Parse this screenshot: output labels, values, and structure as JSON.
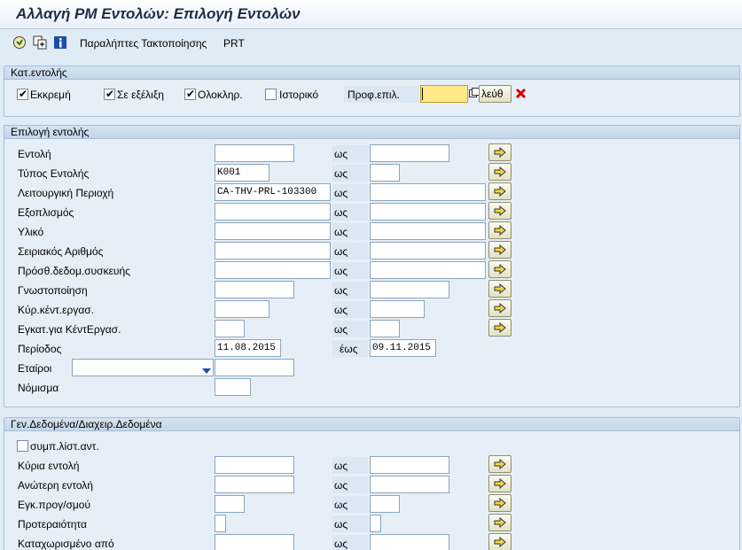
{
  "window": {
    "title": "Αλλαγή PM Εντολών: Επιλογή Εντολών"
  },
  "toolbar": {
    "execute_icon": "execute-icon",
    "copy_icon": "copy-icon",
    "info_icon": "info-icon",
    "items": [
      "Παραλήπτες Τακτοποίησης",
      "PRT"
    ]
  },
  "status_group": {
    "title": "Κατ.εντολής",
    "checkboxes": [
      {
        "label": "Εκκρεμή",
        "checked": true
      },
      {
        "label": "Σε εξέλιξη",
        "checked": true
      },
      {
        "label": "Ολοκληρ.",
        "checked": true
      },
      {
        "label": "Ιστορικό",
        "checked": false
      }
    ],
    "profile_label": "Προφ.επιλ.",
    "profile_value": "",
    "free_button": "λεύθ"
  },
  "selection_group": {
    "title": "Επιλογή εντολής",
    "to_label": "ως",
    "period_to_label": "έως",
    "rows": [
      {
        "label": "Εντολή",
        "from": "",
        "to": ""
      },
      {
        "label": "Τύπος Εντολής",
        "from": "K001",
        "to": ""
      },
      {
        "label": "Λειτουργική Περιοχή",
        "from": "CA-THV-PRL-103300",
        "to": ""
      },
      {
        "label": "Εξοπλισμός",
        "from": "",
        "to": ""
      },
      {
        "label": "Υλικό",
        "from": "",
        "to": ""
      },
      {
        "label": "Σειριακός Αριθμός",
        "from": "",
        "to": ""
      },
      {
        "label": "Πρόσθ.δεδομ.συσκευής",
        "from": "",
        "to": ""
      },
      {
        "label": "Γνωστοποίηση",
        "from": "",
        "to": ""
      },
      {
        "label": "Κύρ.κέντ.εργασ.",
        "from": "",
        "to": ""
      },
      {
        "label": "Εγκατ.για ΚέντΕργασ.",
        "from": "",
        "to": ""
      }
    ],
    "period": {
      "label": "Περίοδος",
      "from": "11.08.2015",
      "to": "09.11.2015"
    },
    "partners": {
      "label": "Εταίροι",
      "role": "",
      "value": ""
    },
    "currency": {
      "label": "Νόμισμα",
      "value": ""
    }
  },
  "general_group": {
    "title": "Γεν.Δεδομένα/Διαχειρ.Δεδομένα",
    "hierarchy_checkbox": {
      "label": "συμπ.λίστ.αντ.",
      "checked": false
    },
    "rows": [
      {
        "label": "Κύρια εντολή",
        "from": "",
        "to": ""
      },
      {
        "label": "Ανώτερη εντολή",
        "from": "",
        "to": ""
      },
      {
        "label": "Εγκ.προγ/σμού",
        "from": "",
        "to": ""
      },
      {
        "label": "Προτεραιότητα",
        "from": "",
        "to": ""
      },
      {
        "label": "Καταχωρισμένο από",
        "from": "",
        "to": ""
      }
    ]
  },
  "colors": {
    "background": "#dfebf5",
    "required_field": "#ffe98a",
    "delete_icon": "#d40000"
  }
}
